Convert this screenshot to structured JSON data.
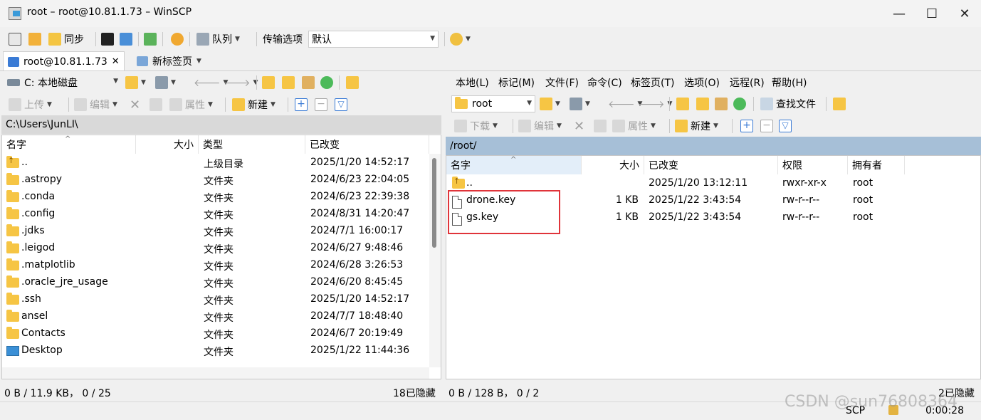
{
  "window": {
    "title": "root – root@10.81.1.73 – WinSCP",
    "minimize": "—",
    "maximize": "☐",
    "close": "✕"
  },
  "toolbar": {
    "sync_label": "同步",
    "queue_label": "队列",
    "transfer_options_label": "传输选项",
    "transfer_options_value": "默认"
  },
  "tabs": [
    {
      "label": "root@10.81.1.73",
      "close": "✕"
    },
    {
      "label": "新标签页"
    }
  ],
  "menu": [
    "本地(L)",
    "标记(M)",
    "文件(F)",
    "命令(C)",
    "标签页(T)",
    "选项(O)",
    "远程(R)",
    "帮助(H)"
  ],
  "local": {
    "drive": "C: 本地磁盘",
    "upload": "上传",
    "edit": "编辑",
    "properties": "属性",
    "new": "新建",
    "path": "C:\\Users\\JunLI\\",
    "columns": [
      "名字",
      "大小",
      "类型",
      "已改变"
    ],
    "rows": [
      {
        "name": "..",
        "size": "",
        "type": "上级目录",
        "changed": "2025/1/20 14:52:17",
        "icon": "up-folder"
      },
      {
        "name": ".astropy",
        "size": "",
        "type": "文件夹",
        "changed": "2024/6/23 22:04:05",
        "icon": "folder"
      },
      {
        "name": ".conda",
        "size": "",
        "type": "文件夹",
        "changed": "2024/6/23 22:39:38",
        "icon": "folder"
      },
      {
        "name": ".config",
        "size": "",
        "type": "文件夹",
        "changed": "2024/8/31 14:20:47",
        "icon": "folder"
      },
      {
        "name": ".jdks",
        "size": "",
        "type": "文件夹",
        "changed": "2024/7/1 16:00:17",
        "icon": "folder"
      },
      {
        "name": ".leigod",
        "size": "",
        "type": "文件夹",
        "changed": "2024/6/27 9:48:46",
        "icon": "folder"
      },
      {
        "name": ".matplotlib",
        "size": "",
        "type": "文件夹",
        "changed": "2024/6/28 3:26:53",
        "icon": "folder"
      },
      {
        "name": ".oracle_jre_usage",
        "size": "",
        "type": "文件夹",
        "changed": "2024/6/20 8:45:45",
        "icon": "folder"
      },
      {
        "name": ".ssh",
        "size": "",
        "type": "文件夹",
        "changed": "2025/1/20 14:52:17",
        "icon": "folder"
      },
      {
        "name": "ansel",
        "size": "",
        "type": "文件夹",
        "changed": "2024/7/7 18:48:40",
        "icon": "folder"
      },
      {
        "name": "Contacts",
        "size": "",
        "type": "文件夹",
        "changed": "2024/6/7 20:19:49",
        "icon": "folder"
      },
      {
        "name": "Desktop",
        "size": "",
        "type": "文件夹",
        "changed": "2025/1/22 11:44:36",
        "icon": "desktop"
      }
    ],
    "status_left": "0 B / 11.9 KB， 0 / 25",
    "status_right": "18已隐藏"
  },
  "remote": {
    "dir": "root",
    "find_files": "查找文件",
    "download": "下载",
    "edit": "编辑",
    "properties": "属性",
    "new": "新建",
    "path": "/root/",
    "columns": [
      "名字",
      "大小",
      "已改变",
      "权限",
      "拥有者"
    ],
    "rows": [
      {
        "name": "..",
        "size": "",
        "changed": "2025/1/20 13:12:11",
        "rights": "rwxr-xr-x",
        "owner": "root",
        "icon": "up-folder"
      },
      {
        "name": "drone.key",
        "size": "1 KB",
        "changed": "2025/1/22 3:43:54",
        "rights": "rw-r--r--",
        "owner": "root",
        "icon": "file"
      },
      {
        "name": "gs.key",
        "size": "1 KB",
        "changed": "2025/1/22 3:43:54",
        "rights": "rw-r--r--",
        "owner": "root",
        "icon": "file"
      }
    ],
    "status_left": "0 B / 128 B， 0 / 2",
    "status_right": "2已隐藏"
  },
  "bottom": {
    "protocol": "SCP",
    "timer": "0:00:28"
  },
  "watermark": "CSDN @sun76808364"
}
